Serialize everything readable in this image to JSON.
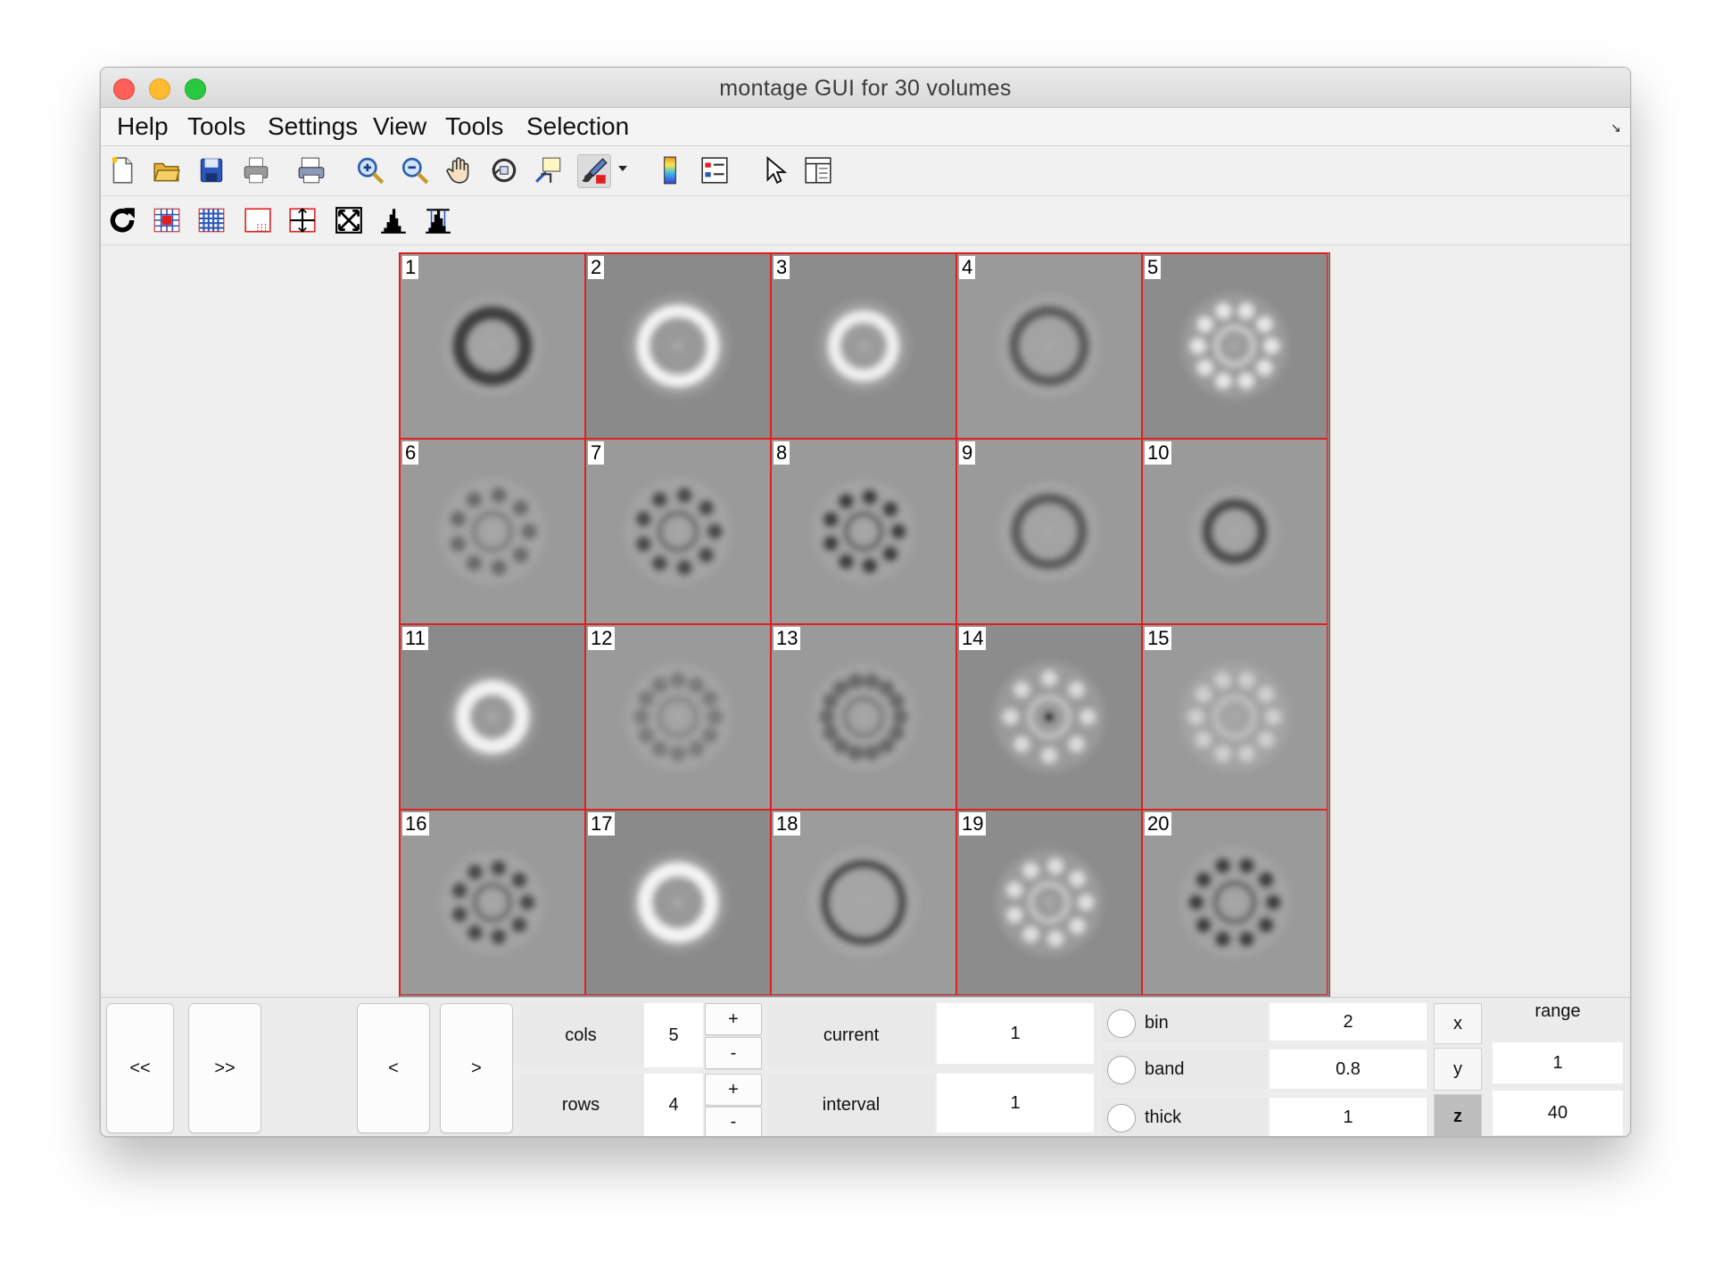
{
  "window": {
    "title": "montage GUI for 30 volumes"
  },
  "menu": [
    "Help",
    "Tools",
    "Settings",
    "View",
    "Tools",
    "Selection"
  ],
  "toolbar_row1_icons": [
    "new-file-icon",
    "open-folder-icon",
    "save-icon",
    "print-icon",
    "print-preview-icon",
    "zoom-in-icon",
    "zoom-out-icon",
    "pan-hand-icon",
    "rotate-3d-icon",
    "data-cursor-icon",
    "brush-icon",
    "colorbar-icon",
    "legend-icon",
    "pointer-icon",
    "property-inspector-icon"
  ],
  "toolbar_row2_icons": [
    "refresh-icon",
    "grid-small-icon",
    "grid-large-icon",
    "single-frame-icon",
    "center-cross-icon",
    "fit-expand-icon",
    "histogram-icon",
    "histogram-range-icon"
  ],
  "montage": {
    "tiles": [
      "1",
      "2",
      "3",
      "4",
      "5",
      "6",
      "7",
      "8",
      "9",
      "10",
      "11",
      "12",
      "13",
      "14",
      "15",
      "16",
      "17",
      "18",
      "19",
      "20"
    ]
  },
  "controls": {
    "first": "<<",
    "last": ">>",
    "prev": "<",
    "next": ">",
    "cols_label": "cols",
    "cols_value": "5",
    "rows_label": "rows",
    "rows_value": "4",
    "plus": "+",
    "minus": "-",
    "current_label": "current",
    "current_value": "1",
    "interval_label": "interval",
    "interval_value": "1",
    "bin_label": "bin",
    "bin_value": "2",
    "band_label": "band",
    "band_value": "0.8",
    "thick_label": "thick",
    "thick_value": "1",
    "axis_x": "x",
    "axis_y": "y",
    "axis_z": "z",
    "range_label": "range",
    "range_min": "1",
    "range_max": "40"
  }
}
